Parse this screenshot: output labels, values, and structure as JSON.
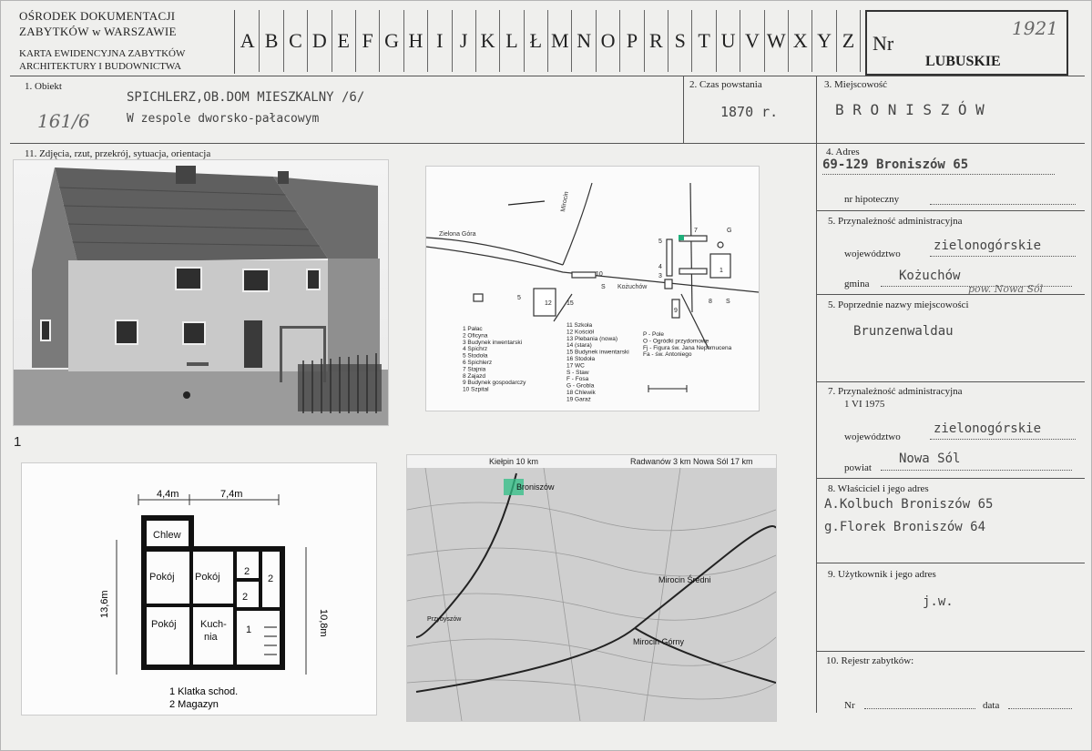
{
  "header": {
    "org_line1": "OŚRODEK DOKUMENTACJI",
    "org_line2": "ZABYTKÓW w WARSZAWIE",
    "card_line1": "KARTA EWIDENCYJNA ZABYTKÓW",
    "card_line2": "ARCHITEKTURY I BUDOWNICTWA",
    "letters": [
      "A",
      "B",
      "C",
      "D",
      "E",
      "F",
      "G",
      "H",
      "I",
      "J",
      "K",
      "L",
      "Ł",
      "M",
      "N",
      "O",
      "P",
      "R",
      "S",
      "T",
      "U",
      "V",
      "W",
      "X",
      "Y",
      "Z"
    ],
    "nr_label": "Nr",
    "nr_value": "1921",
    "region": "LUBUSKIE"
  },
  "obiekt": {
    "label": "1. Obiekt",
    "line1": "SPICHLERZ,OB.DOM MIESZKALNY /6/",
    "line2": "W zespole dworsko-pałacowym",
    "hand_note": "161/6"
  },
  "czas": {
    "label": "2. Czas powstania",
    "value": "1870 r."
  },
  "miejscowosc": {
    "label": "3. Miejscowość",
    "value": "B R O N I S Z Ó W"
  },
  "zdjecia": {
    "label": "11. Zdjęcia, rzut, przekrój, sytuacja, orientacja",
    "photo_number": "1"
  },
  "adres": {
    "label": "4. Adres",
    "value": "69-129 Broniszów 65",
    "nr_hip_label": "nr hipoteczny"
  },
  "przynaleznosc5": {
    "label": "5. Przynależność administracyjna",
    "woj_label": "województwo",
    "woj_value": "zielonogórskie",
    "gmina_label": "gmina",
    "gmina_value": "Kożuchów",
    "gmina_note": "pow. Nowa Sól"
  },
  "poprzednie": {
    "label": "5. Poprzednie nazwy miejscowości",
    "value": "Brunzenwaldau"
  },
  "przynaleznosc7": {
    "label": "7. Przynależność administracyjna",
    "date": "1 VI 1975",
    "woj_label": "województwo",
    "woj_value": "zielonogórskie",
    "powiat_label": "powiat",
    "powiat_value": "Nowa Sól"
  },
  "wlasciciel": {
    "label": "8. Właściciel i jego adres",
    "line1": "A.Kolbuch Broniszów 65",
    "line2": "g.Florek Broniszów 64"
  },
  "uzytkownik": {
    "label": "9. Użytkownik i jego adres",
    "value": "j.w."
  },
  "rejestr": {
    "label": "10. Rejestr zabytków:",
    "nr_label": "Nr",
    "data_label": "data"
  },
  "plan_map": {
    "legend_col1": [
      "1 Pałac",
      "2 Oficyna",
      "3 Budynek inwentarski",
      "4 Spichrz",
      "5 Stodoła",
      "6 Spichlerz",
      "7 Stajnia",
      "8 Zajazd",
      "9 Budynek gospodarczy",
      "10 Szpital"
    ],
    "legend_col2": [
      "11 Szkoła",
      "12 Kościół",
      "13 Plebania (nowa)",
      "14 (stara)",
      "15 Budynek inwentarski",
      "16 Stodoła",
      "17 WC",
      "S - Staw",
      "F - Fosa",
      "G - Grobla",
      "18 Chlewik",
      "19 Garaż"
    ],
    "legend_col3": [
      "P - Pole",
      "O - Ogródki przydomowe",
      "Fj - Figura św. Jana Nepomucena",
      "Fa - św. Antoniego"
    ],
    "road_label_left": "Zielona Góra",
    "road_label_mid": "Kożuchów",
    "road_label_top": "Mirocin"
  },
  "floor_plan": {
    "dim_top1": "4,4m",
    "dim_top2": "7,4m",
    "dim_right": "10,8m",
    "dim_left": "13,6m",
    "rooms": [
      "Chlew",
      "Pokój",
      "Pokój",
      "Pokój",
      "Kuch-nia",
      "1",
      "2",
      "2",
      "2"
    ],
    "legend1": "1 Klatka schod.",
    "legend2": "2 Magazyn"
  },
  "topo": {
    "top_left": "Kiełpin 10 km",
    "top_right": "Radwanów 3 km  Nowa Sól 17 km",
    "labels": [
      "Broniszów",
      "Mirocin Średni",
      "Mirocin Górny",
      "Przybyszów"
    ]
  }
}
